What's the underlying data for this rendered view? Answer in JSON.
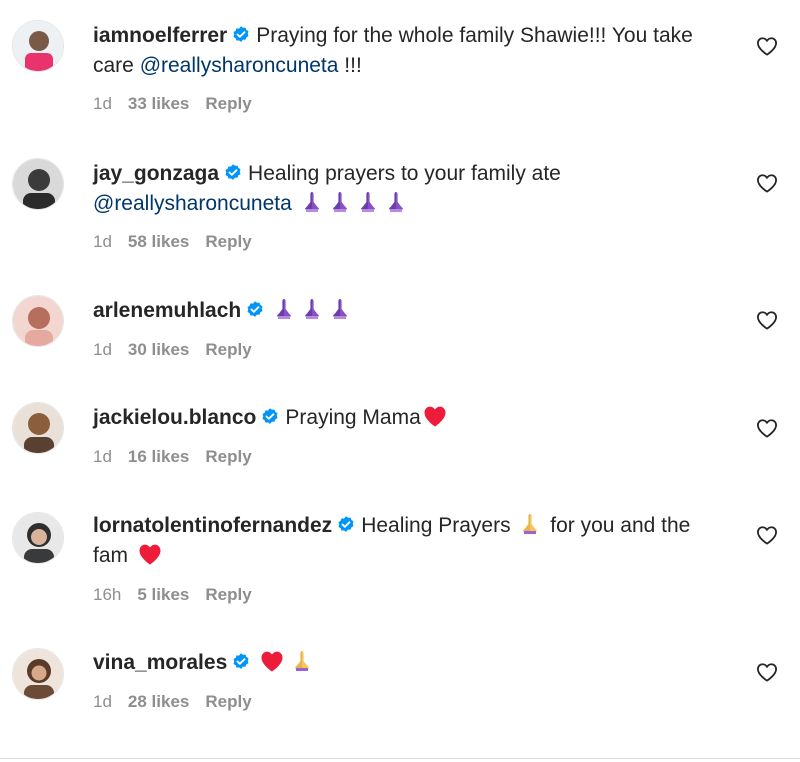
{
  "comments": [
    {
      "username": "iamnoelferrer",
      "text_before": "Praying for the whole family Shawie!!! You take care ",
      "mention": "@reallysharoncuneta",
      "text_after": " !!!",
      "time": "1d",
      "likes": "33 likes",
      "reply": "Reply"
    },
    {
      "username": "jay_gonzaga",
      "text_before": "Healing prayers to your family ate ",
      "mention": "@reallysharoncuneta",
      "text_after": "",
      "emoji": [
        "praying-hands",
        "praying-hands",
        "praying-hands",
        "praying-hands"
      ],
      "time": "1d",
      "likes": "58 likes",
      "reply": "Reply"
    },
    {
      "username": "arlenemuhlach",
      "text_before": "",
      "emoji": [
        "praying-hands",
        "praying-hands",
        "praying-hands"
      ],
      "time": "1d",
      "likes": "30 likes",
      "reply": "Reply"
    },
    {
      "username": "jackielou.blanco",
      "text_before": "Praying Mama",
      "emoji": [
        "red-heart"
      ],
      "time": "1d",
      "likes": "16 likes",
      "reply": "Reply"
    },
    {
      "username": "lornatolentinofernandez",
      "text_before": "Healing Prayers ",
      "text_mid": " for you and the fam ",
      "emoji": [
        "praying-hands-light",
        "red-heart"
      ],
      "time": "16h",
      "likes": "5 likes",
      "reply": "Reply"
    },
    {
      "username": "vina_morales",
      "text_before": "",
      "emoji": [
        "red-heart",
        "praying-hands-light"
      ],
      "time": "1d",
      "likes": "28 likes",
      "reply": "Reply"
    }
  ],
  "colors": {
    "text": "#262626",
    "meta": "#8e8e8e",
    "mention": "#00376b",
    "verified": "#0095f6",
    "heart_red": "#ed1c3a",
    "praying_purple": "#8a4fc7"
  },
  "icons": {
    "verified": "verified-badge-icon",
    "like": "heart-outline-icon"
  }
}
